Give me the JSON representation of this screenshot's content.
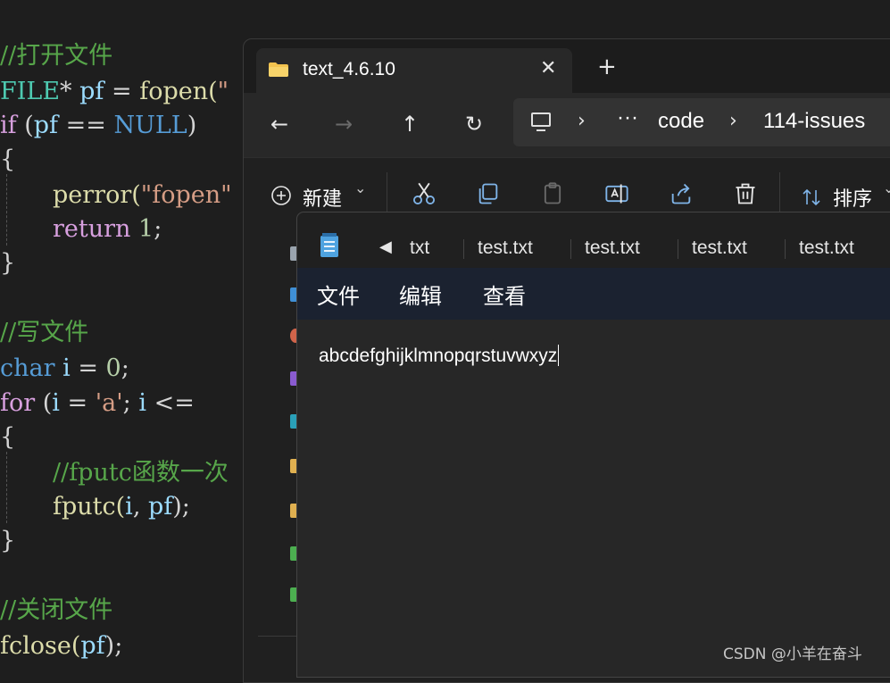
{
  "editor": {
    "comment_open": "//打开文件",
    "line_file": {
      "type": "FILE",
      "star": "*",
      "var": " pf",
      "eq": " = ",
      "fn": "fopen(",
      "rest": "\""
    },
    "line_if": {
      "kw": "if",
      "open": " (",
      "var": "pf",
      "op": " == ",
      "null": "NULL",
      "close": ")"
    },
    "brace_open_1": "{",
    "line_perror": {
      "fn": "perror(",
      "str": "\"fopen\""
    },
    "line_return": {
      "kw": "return",
      "num": " 1",
      "semi": ";"
    },
    "brace_close_1": "}",
    "comment_write": "//写文件",
    "line_char": {
      "kw": "char",
      "var": " i",
      "eq": " = ",
      "num": "0",
      "semi": ";"
    },
    "line_for": {
      "kw": "for",
      "open": " (",
      "var": "i",
      "eq": " = ",
      "str": "'a'",
      "semi": "; ",
      "var2": "i",
      "op": " <="
    },
    "brace_open_2": "{",
    "comment_fputc": "//fputc函数一次",
    "line_fputc": {
      "fn": "fputc(",
      "var": "i",
      "comma": ", ",
      "var2": "pf",
      "close": ");"
    },
    "brace_close_2": "}",
    "comment_close": "//关闭文件",
    "line_fclose": {
      "fn": "fclose(",
      "var": "pf",
      "close": ");"
    }
  },
  "explorer": {
    "tab_title": "text_4.6.10",
    "close_glyph": "✕",
    "new_tab_glyph": "+",
    "nav": {
      "back": "←",
      "forward": "→",
      "up": "↑",
      "refresh": "↻"
    },
    "breadcrumb": {
      "more": "···",
      "sep": "›",
      "items": [
        "code",
        "114-issues"
      ]
    },
    "toolbar": {
      "new_label": "新建",
      "new_chevron": "⌄",
      "sort_label": "排序",
      "sort_chevron": "⌄"
    }
  },
  "notepad": {
    "back_glyph": "◀",
    "tabs": [
      "txt",
      "test.txt",
      "test.txt",
      "test.txt",
      "test.txt"
    ],
    "menu": [
      "文件",
      "编辑",
      "查看"
    ],
    "content": "abcdefghijklmnopqrstuvwxyz"
  },
  "watermark": "CSDN @小羊在奋斗",
  "colors": {
    "comment": "#57a64a",
    "keyword": "#569cd6",
    "function": "#dcdcaa",
    "variable": "#9cdcfe",
    "accent": "#7fb4e8"
  }
}
